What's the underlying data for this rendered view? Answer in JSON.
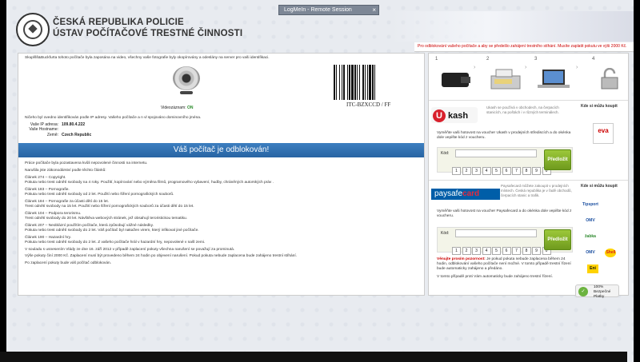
{
  "logmein": {
    "title": "LogMeIn - Remote Session",
    "close": "×"
  },
  "header": {
    "line1": "Česká Republika Policie",
    "line2": "Ústav Počítačové Trestné Činnosti"
  },
  "banner": "Pro odblokování vašeho počítače a aby se předešlo zahájení trestního stíhání. Musíte zaplatit pokutu ve výši 2000 Kč.",
  "left": {
    "intro": "Skuplšš&Buckfurta tohoto počítače byla zaposána na video, všechny vaše fotografie byly okopírovány a odeslány na server pro vaši identifikaci.",
    "cam_label": "Videozáznam:",
    "cam_status": "ON",
    "barcode_text": "ITC-BZXCCD / FF",
    "ip_line": "Ničeho byl ovedno identifikován podle IP adresy. Vašeho počítače a n vl spojováno dominovního jména.",
    "info": [
      {
        "label": "Vaše IP adresa:",
        "value": "109.80.4.222"
      },
      {
        "label": "Vaše Hostname:",
        "value": ""
      },
      {
        "label": "Země:",
        "value": "Czech Republic"
      }
    ],
    "unlock": "Váš počítač je odblokován!",
    "laws": [
      "Práce počítače byla pozastavena kvůli nepovolené činnosti na internetu.",
      "Narušila jste zákonodárství podle těchto článků:",
      "Článek 274 – Copyright.\nPokuta nebo trest odnětí svobody na 4 roky. Použití, kopírování nebo výměna filmů, programového vybavení, hudby, chráněných autorských práv .",
      "Článek 183 – Pornografie.\nPokuta nebo trest odnětí svobody od 2 let. Použití nebo šíření pornografických souborů.",
      "Článek 184 – Pornografie za účasti dětí do 15 let.\nTrest odnětí svobody na 15 let. Použití nebo šíření pornografických souborů za účasti dětí do 15 let.",
      "Článek 104 – Podpora terorismu.\nTrest odnětí svobody do 20 let. Návštěva webových stránek, jež obsahují teroristickou tematiku.",
      "Článek 207 – Neoblázní použítím počítače, která způsobují vážné následky.\nPokuta nebo trest odnětí svobody do 2 let. Váš počítač byl nakažen virem, který infikoval jiné počítače.",
      "Článek 190 – Hazardní hry.\nPokuta nebo trest odnětí svobody do 2 let. Z vašeho počítače hrál v hazardní hry, nepovolené v našl zemi.",
      "V souladu s usnesením Vlády ze dne 16. září 2012 v případě zaplacení pokuty všechna narušení se považují za prominutá.",
      "Výše pokuty činí 2000 Kč. Zaplacení musí být provedeno během 24 hodin po objevení narušení. Pokud pokuta nebude zaplacena bude zahájeno trestní stíhání.",
      "Po zaplacení pokuty bude váš počítač odblokován."
    ]
  },
  "steps": [
    "1",
    "2",
    "3",
    "4"
  ],
  "ukash": {
    "logo": "kash",
    "logo_u": "U",
    "desc": "Ukash se používá v obchodech, na čerpacích stanicích, na poštách i v různých terminálech.",
    "where": "Kde si můžu koupit",
    "instr": "Vyměňte vaši hotovost na voucher Ukash v prodejních střediscích a do okénka dole vepište kód z voucheru.",
    "kod": "Kód:",
    "pay": "Předložit",
    "keys": [
      "1",
      "2",
      "3",
      "4",
      "5",
      "6",
      "7",
      "8",
      "9",
      "0"
    ],
    "eva": "eva"
  },
  "psc": {
    "logo_a": "paysafe",
    "logo_b": "card",
    "desc": "Paysafecard můžete zakoupit v prodejních místech. Česká republika je v řadě obchodů, čerpacích stanic a trafik.",
    "where": "Kde si můžu koupit",
    "instr": "Vyměňte vaši hotovost na voucher Paysafecard a do okénka dole vepište kód z voucheru.",
    "kod": "Kód:",
    "pay": "Předložit",
    "keys": [
      "1",
      "2",
      "3",
      "4",
      "5",
      "6",
      "7",
      "8",
      "9",
      "0"
    ],
    "shops": [
      "Tipsport",
      "OMV",
      "žabka",
      "OMV",
      "Shell",
      "Eni"
    ],
    "warn_red": "Věnujte prosím pozornost:",
    "warn": " Je pokud pokuta nebude zaplacena během 24 hodin, odblokování vašeho počítače není možné. V tomto případě trestní řízení bude automaticky zahájeno a předáno.",
    "warn2": "V tomto případě proti Vám automaticky bude zahájeno trestní řízení.",
    "secure_pct": "100%",
    "secure_lbl": "Bezpečné Platby"
  }
}
